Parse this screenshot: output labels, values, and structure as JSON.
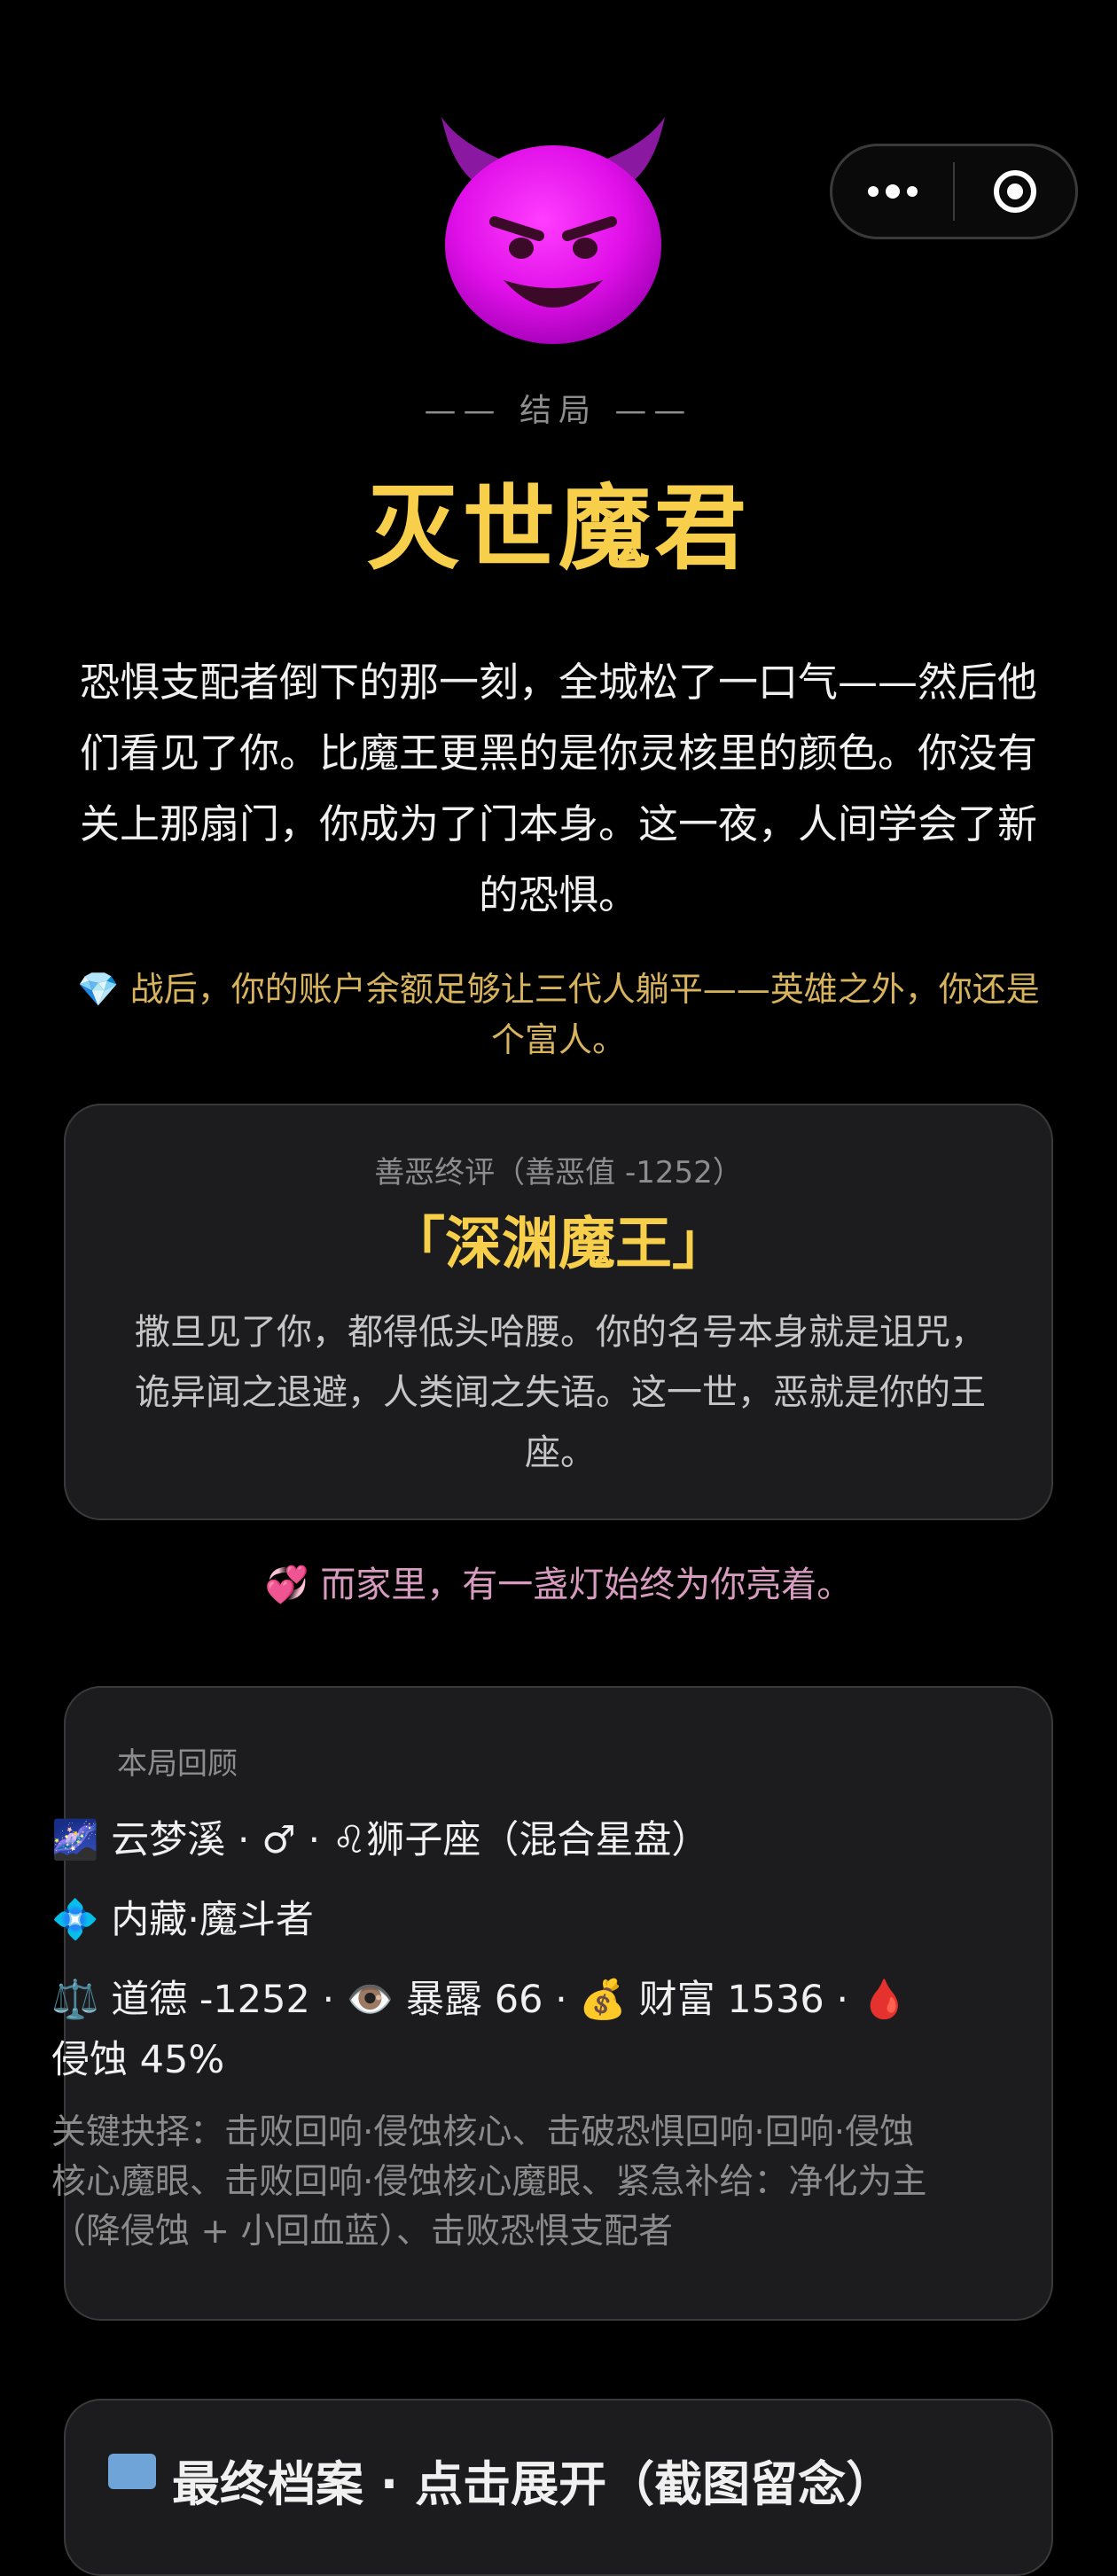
{
  "ending": {
    "kicker": "—— 结局 ——",
    "title": "灭世魔君",
    "story": "恐惧支配者倒下的那一刻，全城松了一口气——然后他们看见了你。比魔王更黑的是你灵核里的颜色。你没有关上那扇门，你成为了门本身。这一夜，人间学会了新的恐惧。",
    "wealth_icon": "gem-icon",
    "wealth_text": "战后，你的账户余额足够让三代人躺平——英雄之外，你还是个富人。"
  },
  "verdict": {
    "label": "善恶终评（善恶值 -1252）",
    "title": "「深渊魔王」",
    "description": "撒旦见了你，都得低头哈腰。你的名号本身就是诅咒，诡异闻之退避，人类闻之失语。这一世，恶就是你的王座。"
  },
  "home_line": {
    "icon": "heart-icon",
    "text": "而家里，有一盏灯始终为你亮着。"
  },
  "review": {
    "label": "本局回顾",
    "origin_line": "云梦溪 · ♂ · ♌狮子座（混合星盘）",
    "class_line": "内藏·魔斗者",
    "stats_line": "⚖️ 道德 -1252 · 👁️ 暴露 66 · 💰 财富 1536 · 🩸 侵蚀 45%",
    "key_choices": "关键抉择：击败回响·侵蚀核心、击破恐惧回响·回响·侵蚀核心魔眼、击败回响·侵蚀核心魔眼、紧急补给：净化为主（降侵蚀 + 小回血蓝）、击败恐惧支配者"
  },
  "archive": {
    "title": "最终档案 · 点击展开（截图留念）"
  },
  "colors": {
    "accent_gold": "#f7cf4a",
    "wealth_text": "#d8b35e",
    "home_text": "#d79bbf",
    "card_bg": "#1c1c1e"
  }
}
